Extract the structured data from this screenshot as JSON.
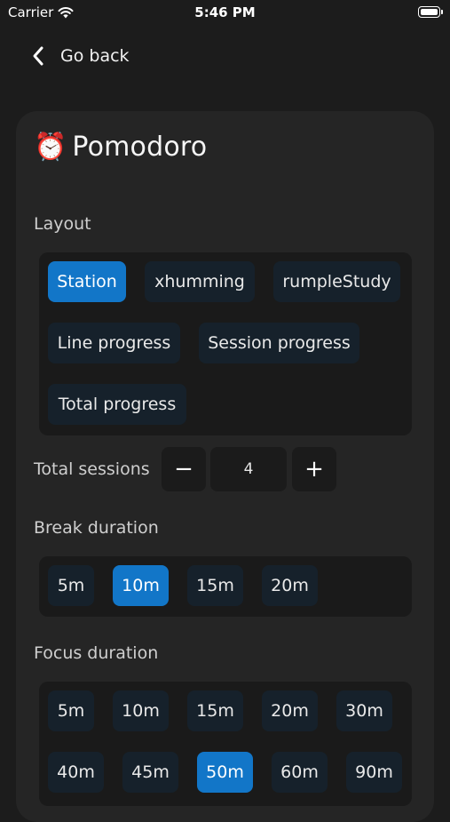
{
  "status_bar": {
    "carrier": "Carrier",
    "time": "5:46 PM"
  },
  "nav": {
    "back_label": "Go back"
  },
  "card": {
    "icon": "⏰",
    "title": "Pomodoro",
    "layout": {
      "label": "Layout",
      "options": [
        "Station",
        "xhumming",
        "rumpleStudy",
        "Line progress",
        "Session progress",
        "Total progress"
      ],
      "selected": "Station"
    },
    "total_sessions": {
      "label": "Total sessions",
      "value": "4",
      "decrement": "−",
      "increment": "+"
    },
    "break_duration": {
      "label": "Break duration",
      "options": [
        "5m",
        "10m",
        "15m",
        "20m"
      ],
      "selected": "10m"
    },
    "focus_duration": {
      "label": "Focus duration",
      "options": [
        "5m",
        "10m",
        "15m",
        "20m",
        "30m",
        "40m",
        "45m",
        "50m",
        "60m",
        "90m"
      ],
      "selected": "50m"
    }
  }
}
